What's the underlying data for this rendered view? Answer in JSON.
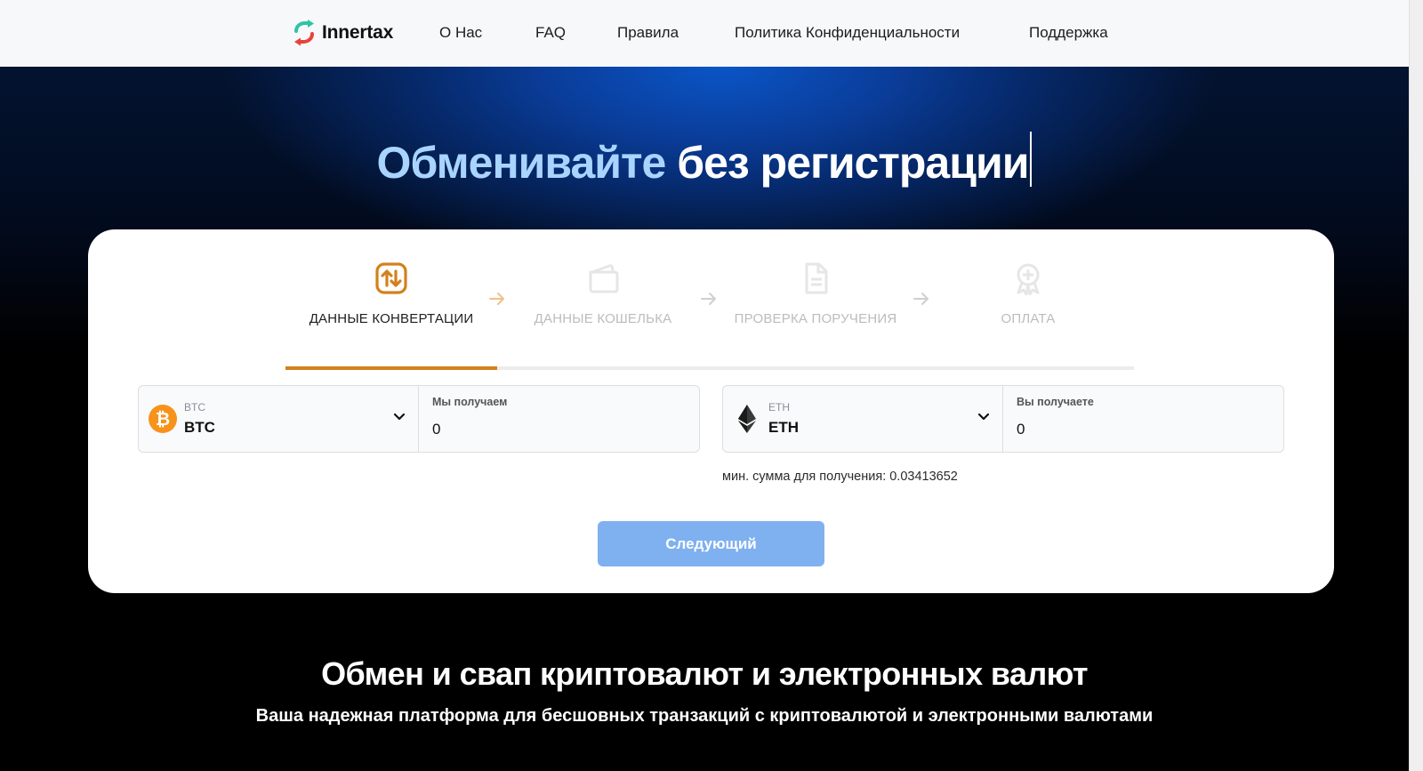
{
  "header": {
    "logo_text": "Innertax",
    "nav": [
      {
        "label": "О Нас"
      },
      {
        "label": "FAQ"
      },
      {
        "label": "Правила"
      },
      {
        "label": "Политика Конфиденциальности"
      },
      {
        "label": "Поддержка"
      }
    ]
  },
  "hero": {
    "title_accent": "Обменивайте",
    "title_rest": "без регистрации"
  },
  "steps": [
    {
      "label": "ДАННЫЕ КОНВЕРТАЦИИ",
      "icon": "swap-icon",
      "active": true
    },
    {
      "label": "ДАННЫЕ КОШЕЛЬКА",
      "icon": "wallet-icon",
      "active": false
    },
    {
      "label": "ПРОВЕРКА ПОРУЧЕНИЯ",
      "icon": "document-icon",
      "active": false
    },
    {
      "label": "ОПЛАТА",
      "icon": "award-icon",
      "active": false
    }
  ],
  "send": {
    "coin_small": "BTC",
    "coin_big": "BTC",
    "amount_label": "Мы получаем",
    "amount_value": "0",
    "icon": "bitcoin-icon",
    "icon_color": "#f7931a"
  },
  "receive": {
    "coin_small": "ETH",
    "coin_big": "ETH",
    "amount_label": "Вы получаете",
    "amount_value": "0",
    "icon": "ethereum-icon"
  },
  "min_note": "мин. сумма для получения: 0.03413652",
  "next_button": "Следующий",
  "section": {
    "title": "Обмен и свап криптовалют и электронных валют",
    "subtitle": "Ваша надежная платформа для бесшовных транзакций с криптовалютой и электронными валютами"
  },
  "colors": {
    "accent": "#d4801d",
    "button": "#7fb0ef",
    "hero_accent_text": "#a8d4ff"
  }
}
